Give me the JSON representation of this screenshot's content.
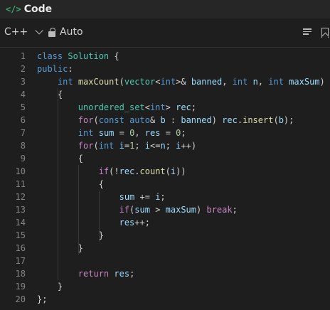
{
  "header": {
    "title": "Code",
    "icon": "code-brackets-icon"
  },
  "toolbar": {
    "language": "C++",
    "mode": "Auto"
  },
  "editor": {
    "lines": [
      {
        "n": "1",
        "tokens": [
          [
            "kw",
            "class"
          ],
          [
            "",
            " "
          ],
          [
            "ty",
            "Solution"
          ],
          [
            "",
            " {"
          ]
        ]
      },
      {
        "n": "2",
        "tokens": [
          [
            "kw",
            "public"
          ],
          [
            "",
            ":"
          ]
        ]
      },
      {
        "n": "3",
        "tokens": [
          [
            "",
            "    "
          ],
          [
            "kw",
            "int"
          ],
          [
            "",
            " "
          ],
          [
            "fn",
            "maxCount"
          ],
          [
            "",
            "("
          ],
          [
            "ty",
            "vector"
          ],
          [
            "",
            "<"
          ],
          [
            "kw",
            "int"
          ],
          [
            "",
            ">& "
          ],
          [
            "var",
            "banned"
          ],
          [
            "",
            ", "
          ],
          [
            "kw",
            "int"
          ],
          [
            "",
            " "
          ],
          [
            "var",
            "n"
          ],
          [
            "",
            ", "
          ],
          [
            "kw",
            "int"
          ],
          [
            "",
            " "
          ],
          [
            "var",
            "maxSum"
          ],
          [
            "",
            ")"
          ]
        ]
      },
      {
        "n": "4",
        "tokens": [
          [
            "",
            "    {"
          ]
        ]
      },
      {
        "n": "5",
        "tokens": [
          [
            "",
            "        "
          ],
          [
            "ty",
            "unordered_set"
          ],
          [
            "",
            "<"
          ],
          [
            "kw",
            "int"
          ],
          [
            "",
            "> "
          ],
          [
            "var",
            "rec"
          ],
          [
            "",
            ";"
          ]
        ]
      },
      {
        "n": "6",
        "tokens": [
          [
            "",
            "        "
          ],
          [
            "ctrl",
            "for"
          ],
          [
            "",
            "("
          ],
          [
            "kw",
            "const"
          ],
          [
            "",
            " "
          ],
          [
            "kw",
            "auto"
          ],
          [
            "",
            "& "
          ],
          [
            "var",
            "b"
          ],
          [
            "",
            " : "
          ],
          [
            "var",
            "banned"
          ],
          [
            "",
            ") "
          ],
          [
            "var",
            "rec"
          ],
          [
            "",
            "."
          ],
          [
            "fn",
            "insert"
          ],
          [
            "",
            "("
          ],
          [
            "var",
            "b"
          ],
          [
            "",
            ");"
          ]
        ]
      },
      {
        "n": "7",
        "tokens": [
          [
            "",
            "        "
          ],
          [
            "kw",
            "int"
          ],
          [
            "",
            " "
          ],
          [
            "var",
            "sum"
          ],
          [
            "",
            " = "
          ],
          [
            "num",
            "0"
          ],
          [
            "",
            ", "
          ],
          [
            "var",
            "res"
          ],
          [
            "",
            " = "
          ],
          [
            "num",
            "0"
          ],
          [
            "",
            ";"
          ]
        ]
      },
      {
        "n": "8",
        "tokens": [
          [
            "",
            "        "
          ],
          [
            "ctrl",
            "for"
          ],
          [
            "",
            "("
          ],
          [
            "kw",
            "int"
          ],
          [
            "",
            " "
          ],
          [
            "var",
            "i"
          ],
          [
            "",
            "="
          ],
          [
            "num",
            "1"
          ],
          [
            "",
            "; "
          ],
          [
            "var",
            "i"
          ],
          [
            "",
            "<="
          ],
          [
            "var",
            "n"
          ],
          [
            "",
            "; "
          ],
          [
            "var",
            "i"
          ],
          [
            "",
            "++)"
          ]
        ]
      },
      {
        "n": "9",
        "tokens": [
          [
            "",
            "        {"
          ]
        ]
      },
      {
        "n": "10",
        "tokens": [
          [
            "",
            "            "
          ],
          [
            "ctrl",
            "if"
          ],
          [
            "",
            "(!"
          ],
          [
            "var",
            "rec"
          ],
          [
            "",
            "."
          ],
          [
            "fn",
            "count"
          ],
          [
            "",
            "("
          ],
          [
            "var",
            "i"
          ],
          [
            "",
            "))"
          ]
        ]
      },
      {
        "n": "11",
        "tokens": [
          [
            "",
            "            {"
          ]
        ]
      },
      {
        "n": "12",
        "tokens": [
          [
            "",
            "                "
          ],
          [
            "var",
            "sum"
          ],
          [
            "",
            " += "
          ],
          [
            "var",
            "i"
          ],
          [
            "",
            ";"
          ]
        ]
      },
      {
        "n": "13",
        "tokens": [
          [
            "",
            "                "
          ],
          [
            "ctrl",
            "if"
          ],
          [
            "",
            "("
          ],
          [
            "var",
            "sum"
          ],
          [
            "",
            " > "
          ],
          [
            "var",
            "maxSum"
          ],
          [
            "",
            ") "
          ],
          [
            "ctrl",
            "break"
          ],
          [
            "",
            ";"
          ]
        ]
      },
      {
        "n": "14",
        "tokens": [
          [
            "",
            "                "
          ],
          [
            "var",
            "res"
          ],
          [
            "",
            "++;"
          ]
        ]
      },
      {
        "n": "15",
        "tokens": [
          [
            "",
            "            }"
          ]
        ]
      },
      {
        "n": "16",
        "tokens": [
          [
            "",
            "        }"
          ]
        ]
      },
      {
        "n": "17",
        "tokens": []
      },
      {
        "n": "18",
        "tokens": [
          [
            "",
            "        "
          ],
          [
            "ctrl",
            "return"
          ],
          [
            "",
            " "
          ],
          [
            "var",
            "res"
          ],
          [
            "",
            ";"
          ]
        ]
      },
      {
        "n": "19",
        "tokens": [
          [
            "",
            "    }"
          ]
        ]
      },
      {
        "n": "20",
        "tokens": [
          [
            "",
            "};"
          ]
        ]
      }
    ]
  }
}
